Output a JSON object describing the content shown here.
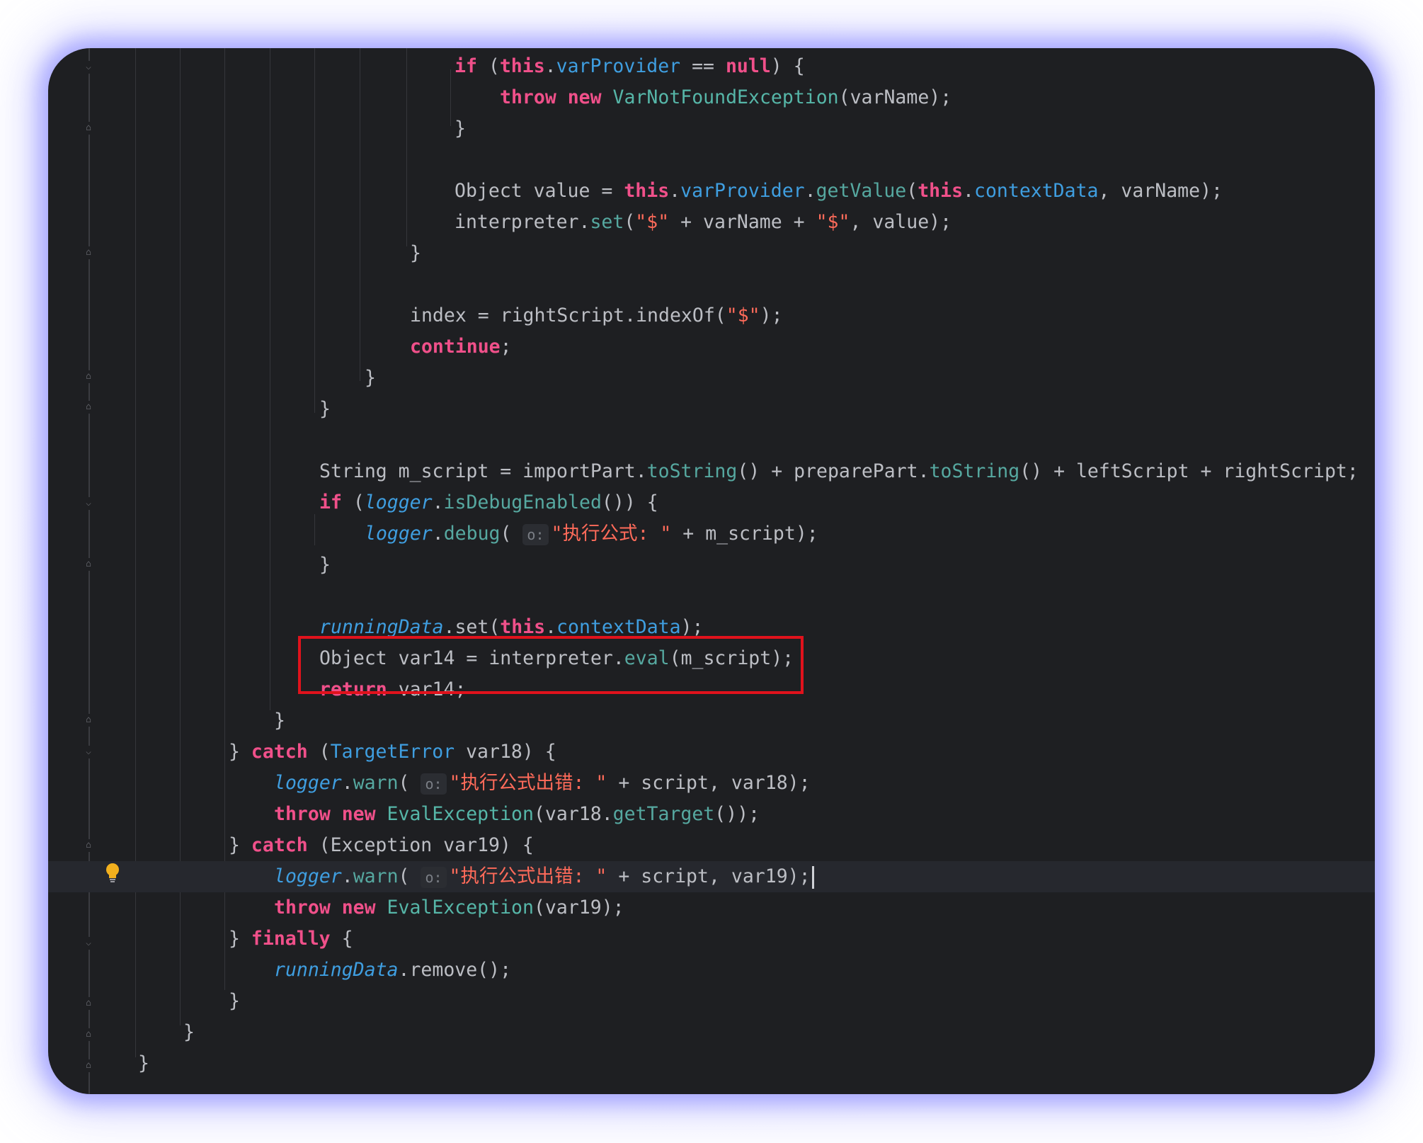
{
  "editor": {
    "lines": [
      {
        "id": "l1",
        "segments": [
          [
            "kw",
            "if"
          ],
          [
            "t",
            " ("
          ],
          [
            "kw",
            "this"
          ],
          [
            "t",
            "."
          ],
          [
            "fld",
            "varProvider"
          ],
          [
            "t",
            " == "
          ],
          [
            "kw",
            "null"
          ],
          [
            "t",
            ") {"
          ]
        ]
      },
      {
        "id": "l2",
        "segments": [
          [
            "kw",
            "throw new "
          ],
          [
            "typ",
            "VarNotFoundException"
          ],
          [
            "t",
            "(varName);"
          ]
        ]
      },
      {
        "id": "l3",
        "segments": [
          [
            "t",
            "}"
          ]
        ]
      },
      {
        "id": "l4",
        "segments": [
          [
            "t",
            "Object value = "
          ],
          [
            "kw",
            "this"
          ],
          [
            "t",
            "."
          ],
          [
            "fld",
            "varProvider"
          ],
          [
            "t",
            "."
          ],
          [
            "mth",
            "getValue"
          ],
          [
            "t",
            "("
          ],
          [
            "kw",
            "this"
          ],
          [
            "t",
            "."
          ],
          [
            "fld",
            "contextData"
          ],
          [
            "t",
            ", varName);"
          ]
        ]
      },
      {
        "id": "l5",
        "segments": [
          [
            "t",
            "interpreter."
          ],
          [
            "mth",
            "set"
          ],
          [
            "t",
            "("
          ],
          [
            "str",
            "\"$\""
          ],
          [
            "t",
            " + varName + "
          ],
          [
            "str",
            "\"$\""
          ],
          [
            "t",
            ", value);"
          ]
        ]
      },
      {
        "id": "l6",
        "segments": [
          [
            "t",
            "}"
          ]
        ]
      },
      {
        "id": "l7",
        "segments": [
          [
            "t",
            "index = rightScript.indexOf("
          ],
          [
            "str",
            "\"$\""
          ],
          [
            "t",
            ");"
          ]
        ]
      },
      {
        "id": "l8",
        "segments": [
          [
            "kw",
            "continue"
          ],
          [
            "t",
            ";"
          ]
        ]
      },
      {
        "id": "l9",
        "segments": [
          [
            "t",
            "}"
          ]
        ]
      },
      {
        "id": "l10",
        "segments": [
          [
            "t",
            "}"
          ]
        ]
      },
      {
        "id": "l11",
        "segments": [
          [
            "t",
            "String m_script = importPart."
          ],
          [
            "mth",
            "toString"
          ],
          [
            "t",
            "() + preparePart."
          ],
          [
            "mth",
            "toString"
          ],
          [
            "t",
            "() + leftScript + rightScript;"
          ]
        ]
      },
      {
        "id": "l12",
        "segments": [
          [
            "kw",
            "if"
          ],
          [
            "t",
            " ("
          ],
          [
            "ital",
            "logger"
          ],
          [
            "t",
            "."
          ],
          [
            "mth",
            "isDebugEnabled"
          ],
          [
            "t",
            "()) {"
          ]
        ]
      },
      {
        "id": "l13",
        "segments": [
          [
            "ital",
            "logger"
          ],
          [
            "t",
            "."
          ],
          [
            "mth",
            "debug"
          ],
          [
            "t",
            "( "
          ],
          [
            "hint",
            "o:"
          ],
          [
            "str",
            "\"执行公式: \""
          ],
          [
            "t",
            " + m_script);"
          ]
        ]
      },
      {
        "id": "l14",
        "segments": [
          [
            "t",
            "}"
          ]
        ]
      },
      {
        "id": "l15",
        "segments": [
          [
            "ital",
            "runningData"
          ],
          [
            "t",
            ".set("
          ],
          [
            "kw",
            "this"
          ],
          [
            "t",
            "."
          ],
          [
            "fld",
            "contextData"
          ],
          [
            "t",
            ");"
          ]
        ]
      },
      {
        "id": "l16",
        "segments": [
          [
            "t",
            "Object var14 = interpreter."
          ],
          [
            "mth",
            "eval"
          ],
          [
            "t",
            "(m_script);"
          ]
        ]
      },
      {
        "id": "l17",
        "segments": [
          [
            "kw",
            "return"
          ],
          [
            "t",
            " var14;"
          ]
        ]
      },
      {
        "id": "l18",
        "segments": [
          [
            "t",
            "}"
          ]
        ]
      },
      {
        "id": "l19",
        "segments": [
          [
            "t",
            "} "
          ],
          [
            "kw",
            "catch"
          ],
          [
            "t",
            " ("
          ],
          [
            "fld",
            "TargetError"
          ],
          [
            "t",
            " var18) {"
          ]
        ]
      },
      {
        "id": "l20",
        "segments": [
          [
            "ital",
            "logger"
          ],
          [
            "t",
            "."
          ],
          [
            "mth",
            "warn"
          ],
          [
            "t",
            "( "
          ],
          [
            "hint",
            "o:"
          ],
          [
            "str",
            "\"执行公式出错: \""
          ],
          [
            "t",
            " + script, var18);"
          ]
        ]
      },
      {
        "id": "l21",
        "segments": [
          [
            "kw",
            "throw new "
          ],
          [
            "typ",
            "EvalException"
          ],
          [
            "t",
            "(var18."
          ],
          [
            "mth",
            "getTarget"
          ],
          [
            "t",
            "());"
          ]
        ]
      },
      {
        "id": "l22",
        "segments": [
          [
            "t",
            "} "
          ],
          [
            "kw",
            "catch"
          ],
          [
            "t",
            " (Exception var19) {"
          ]
        ]
      },
      {
        "id": "l23",
        "segments": [
          [
            "ital",
            "logger"
          ],
          [
            "t",
            "."
          ],
          [
            "mth",
            "warn"
          ],
          [
            "t",
            "( "
          ],
          [
            "hint",
            "o:"
          ],
          [
            "str",
            "\"执行公式出错: \""
          ],
          [
            "t",
            " + script, var19);"
          ]
        ]
      },
      {
        "id": "l24",
        "segments": [
          [
            "kw",
            "throw new "
          ],
          [
            "typ",
            "EvalException"
          ],
          [
            "t",
            "(var19);"
          ]
        ]
      },
      {
        "id": "l25",
        "segments": [
          [
            "t",
            "} "
          ],
          [
            "kw",
            "finally"
          ],
          [
            "t",
            " {"
          ]
        ]
      },
      {
        "id": "l26",
        "segments": [
          [
            "ital",
            "runningData"
          ],
          [
            "t",
            ".remove();"
          ]
        ]
      },
      {
        "id": "l27",
        "segments": [
          [
            "t",
            "}"
          ]
        ]
      },
      {
        "id": "l28",
        "segments": [
          [
            "t",
            "}"
          ]
        ]
      },
      {
        "id": "l29",
        "segments": [
          [
            "t",
            "}"
          ]
        ]
      }
    ]
  },
  "colors": {
    "background": "#1e1f22",
    "keyword": "#f0508a",
    "field": "#3f9ee0",
    "method": "#56a8a0",
    "string": "#ff6b5a",
    "highlight_border": "#e0121c"
  },
  "icons": [
    "fold-marker-icon",
    "lightbulb-icon"
  ]
}
